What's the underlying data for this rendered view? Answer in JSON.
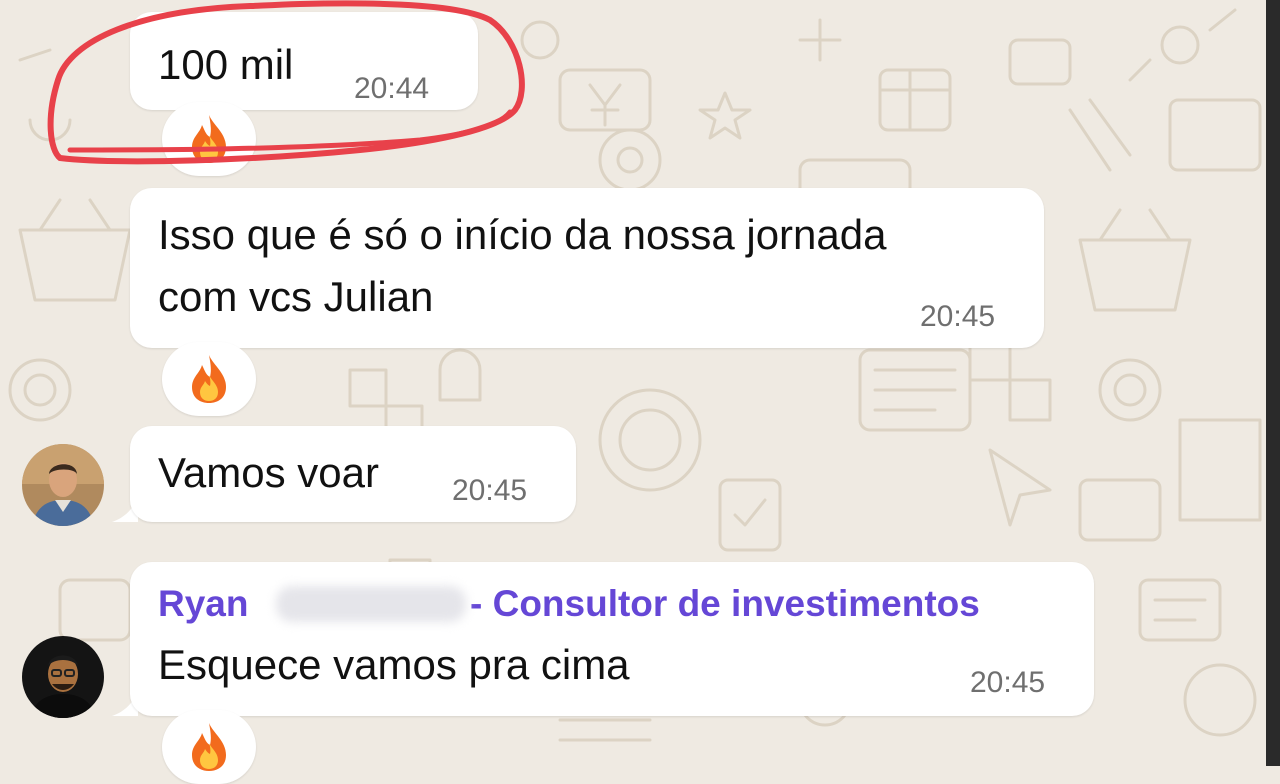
{
  "messages": [
    {
      "text": "100 mil",
      "time": "20:44",
      "reaction": "fire-emoji"
    },
    {
      "lines": [
        "Isso que é só o início da nossa jornada",
        "com vcs Julian"
      ],
      "time": "20:45",
      "reaction": "fire-emoji"
    },
    {
      "text": "Vamos voar",
      "time": "20:45",
      "reaction": null
    },
    {
      "sender": {
        "first": "Ryan",
        "rest": "- Consultor de investimentos"
      },
      "text": "Esquece vamos pra cima",
      "time": "20:45",
      "reaction": "fire-emoji"
    }
  ],
  "colors": {
    "wallpaper": "#efeae2",
    "bubble": "#ffffff",
    "sender_name": "#6547d6",
    "highlight_circle": "#e8414a"
  }
}
